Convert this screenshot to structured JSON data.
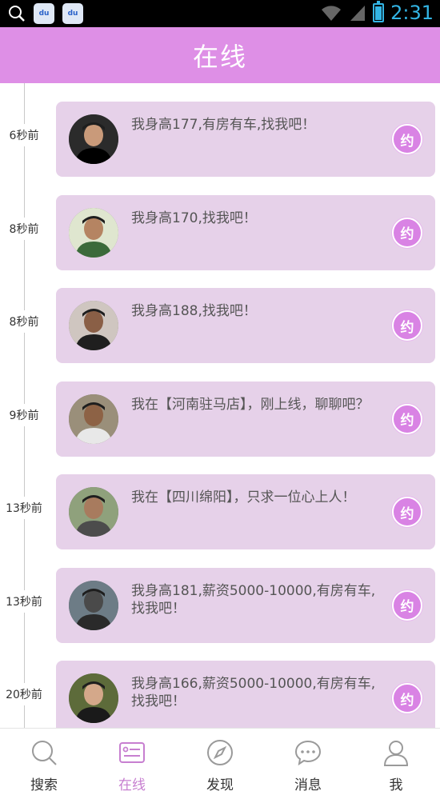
{
  "status_bar": {
    "time": "2:31",
    "app_icons": [
      "du",
      "du"
    ]
  },
  "header": {
    "title": "在线"
  },
  "feed": [
    {
      "time": "6秒前",
      "message": "我身高177,有房有车,找我吧！",
      "action": "约",
      "avatar_colors": [
        "#2b2b2b",
        "#c99a7a",
        "#000000"
      ]
    },
    {
      "time": "8秒前",
      "message": "我身高170,找我吧！",
      "action": "约",
      "avatar_colors": [
        "#dfe6cf",
        "#b58462",
        "#3b6a3a"
      ]
    },
    {
      "time": "8秒前",
      "message": "我身高188,找我吧！",
      "action": "约",
      "avatar_colors": [
        "#cfc6c0",
        "#8a5f46",
        "#1f1f1f"
      ]
    },
    {
      "time": "9秒前",
      "message": "我在【河南驻马店】，刚上线，聊聊吧？",
      "action": "约",
      "avatar_colors": [
        "#9a8f7a",
        "#8d6245",
        "#e8e8e8"
      ]
    },
    {
      "time": "13秒前",
      "message": "我在【四川绵阳】，只求一位心上人！",
      "action": "约",
      "avatar_colors": [
        "#8fa17c",
        "#a87b5e",
        "#4c4c4c"
      ]
    },
    {
      "time": "13秒前",
      "message": "我身高181,薪资5000-10000,有房有车,找我吧！",
      "action": "约",
      "avatar_colors": [
        "#6d7c86",
        "#4a4a4a",
        "#2a2a2a"
      ]
    },
    {
      "time": "20秒前",
      "message": "我身高166,薪资5000-10000,有房有车,找我吧！",
      "action": "约",
      "avatar_colors": [
        "#5d6b3a",
        "#d4a88a",
        "#1a1a1a"
      ]
    }
  ],
  "tabs": [
    {
      "label": "搜索",
      "icon": "search-icon",
      "active": false
    },
    {
      "label": "在线",
      "icon": "online-list-icon",
      "active": true
    },
    {
      "label": "发现",
      "icon": "compass-icon",
      "active": false
    },
    {
      "label": "消息",
      "icon": "chat-bubble-icon",
      "active": false
    },
    {
      "label": "我",
      "icon": "person-icon",
      "active": false
    }
  ],
  "colors": {
    "accent": "#de8fe6",
    "card": "#e6d1e9",
    "active_tab": "#c77fd0"
  }
}
